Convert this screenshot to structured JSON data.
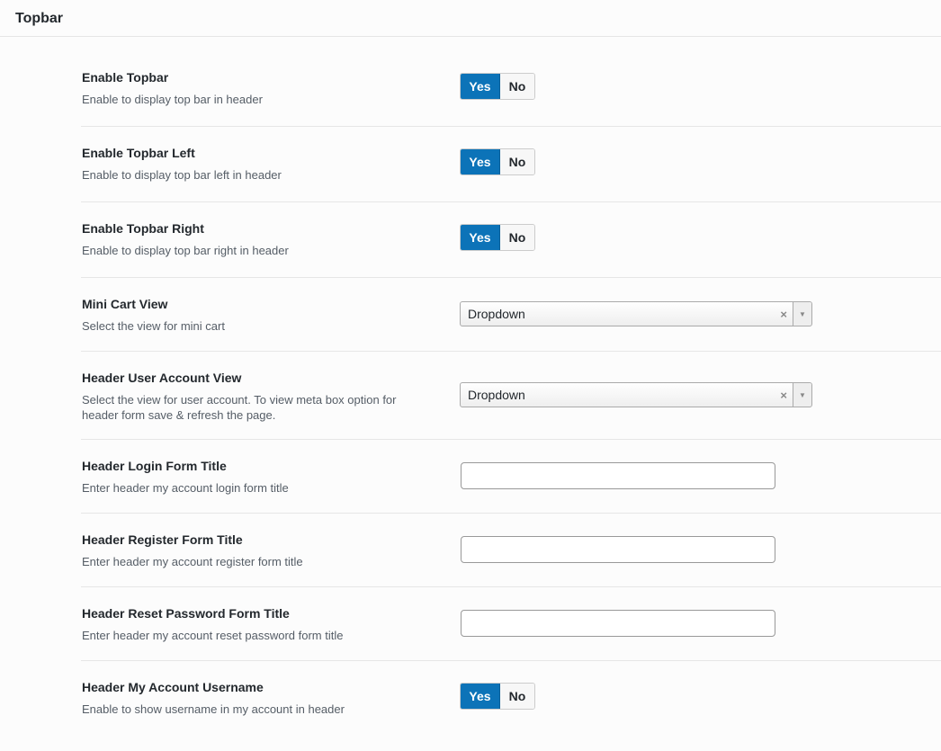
{
  "section": {
    "title": "Topbar"
  },
  "fields": {
    "enable_topbar": {
      "label": "Enable Topbar",
      "description": "Enable to display top bar in header",
      "yes": "Yes",
      "no": "No",
      "selected": "Yes"
    },
    "enable_topbar_left": {
      "label": "Enable Topbar Left",
      "description": "Enable to display top bar left in header",
      "yes": "Yes",
      "no": "No",
      "selected": "Yes"
    },
    "enable_topbar_right": {
      "label": "Enable Topbar Right",
      "description": "Enable to display top bar right in header",
      "yes": "Yes",
      "no": "No",
      "selected": "Yes"
    },
    "mini_cart_view": {
      "label": "Mini Cart View",
      "description": "Select the view for mini cart",
      "value": "Dropdown",
      "clear": "×",
      "arrow": "▼"
    },
    "header_user_account_view": {
      "label": "Header User Account View",
      "description": "Select the view for user account. To view meta box option for header form save & refresh the page.",
      "value": "Dropdown",
      "clear": "×",
      "arrow": "▼"
    },
    "header_login_form_title": {
      "label": "Header Login Form Title",
      "description": "Enter header my account login form title",
      "value": ""
    },
    "header_register_form_title": {
      "label": "Header Register Form Title",
      "description": "Enter header my account register form title",
      "value": ""
    },
    "header_reset_password_form_title": {
      "label": "Header Reset Password Form Title",
      "description": "Enter header my account reset password form title",
      "value": ""
    },
    "header_my_account_username": {
      "label": "Header My Account Username",
      "description": "Enable to show username in my account in header",
      "yes": "Yes",
      "no": "No",
      "selected": "Yes"
    }
  },
  "colors": {
    "toggle_active": "#0c73b8",
    "toggle_inactive": "#f7f7f7",
    "panel_background": "#fcfcfc"
  }
}
